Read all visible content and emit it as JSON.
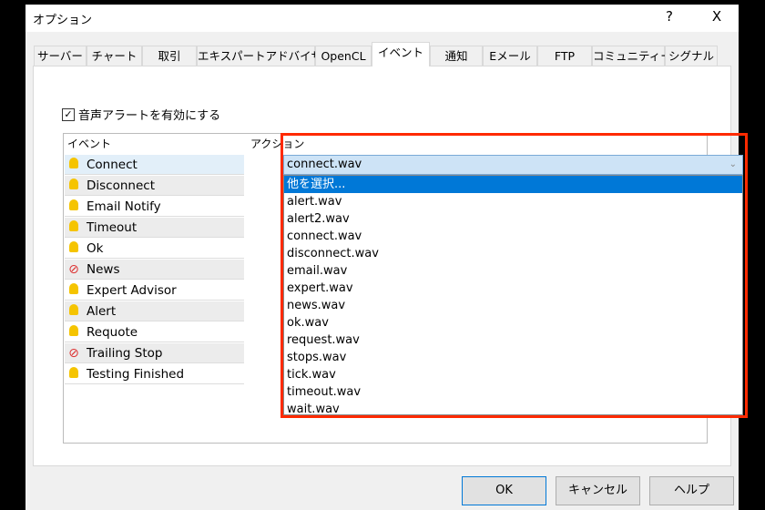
{
  "window": {
    "title": "オプション",
    "help": "?",
    "close": "X"
  },
  "tabs": [
    "サーバー",
    "チャート",
    "取引",
    "エキスパートアドバイザ",
    "OpenCL",
    "イベント",
    "通知",
    "Eメール",
    "FTP",
    "コミュニティー",
    "シグナル"
  ],
  "selected_tab": "イベント",
  "sound_alert": {
    "label": "音声アラートを有効にする",
    "checked": true,
    "mark": "☑"
  },
  "columns": {
    "event": "イベント",
    "action": "アクション"
  },
  "events": [
    {
      "name": "Connect",
      "icon": "bell-icon"
    },
    {
      "name": "Disconnect",
      "icon": "bell-icon"
    },
    {
      "name": "Email Notify",
      "icon": "bell-icon"
    },
    {
      "name": "Timeout",
      "icon": "bell-icon"
    },
    {
      "name": "Ok",
      "icon": "bell-icon"
    },
    {
      "name": "News",
      "icon": "disabled-icon"
    },
    {
      "name": "Expert Advisor",
      "icon": "bell-icon"
    },
    {
      "name": "Alert",
      "icon": "bell-icon"
    },
    {
      "name": "Requote",
      "icon": "bell-icon"
    },
    {
      "name": "Trailing Stop",
      "icon": "disabled-icon"
    },
    {
      "name": "Testing Finished",
      "icon": "bell-icon"
    }
  ],
  "combo": {
    "value": "connect.wav",
    "chevron": "⌄"
  },
  "options": [
    "他を選択...",
    "alert.wav",
    "alert2.wav",
    "connect.wav",
    "disconnect.wav",
    "email.wav",
    "expert.wav",
    "news.wav",
    "ok.wav",
    "request.wav",
    "stops.wav",
    "tick.wav",
    "timeout.wav",
    "wait.wav"
  ],
  "highlight_color": "#ff2a00",
  "buttons": {
    "ok": "OK",
    "cancel": "キャンセル",
    "help": "ヘルプ"
  }
}
